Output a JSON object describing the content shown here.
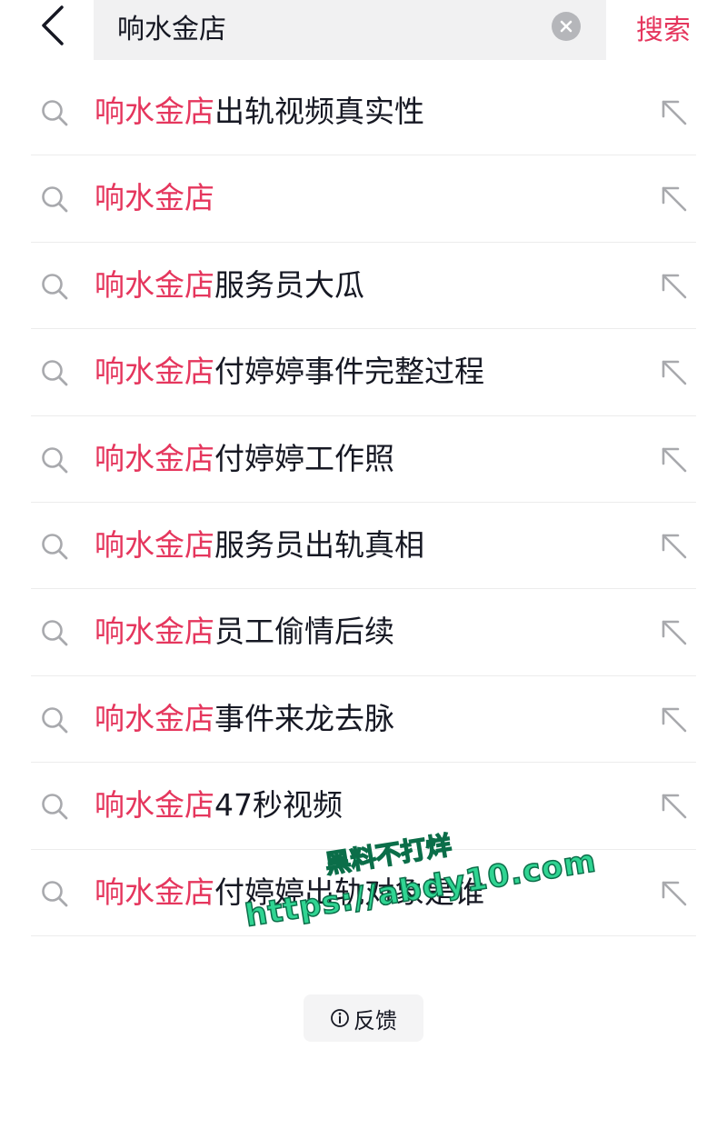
{
  "header": {
    "query": "响水金店",
    "search_label": "搜索"
  },
  "suggestions": [
    {
      "highlight": "响水金店",
      "rest": "出轨视频真实性"
    },
    {
      "highlight": "响水金店",
      "rest": ""
    },
    {
      "highlight": "响水金店",
      "rest": "服务员大瓜"
    },
    {
      "highlight": "响水金店",
      "rest": "付婷婷事件完整过程"
    },
    {
      "highlight": "响水金店",
      "rest": "付婷婷工作照"
    },
    {
      "highlight": "响水金店",
      "rest": "服务员出轨真相"
    },
    {
      "highlight": "响水金店",
      "rest": "员工偷情后续"
    },
    {
      "highlight": "响水金店",
      "rest": "事件来龙去脉"
    },
    {
      "highlight": "响水金店",
      "rest": "47秒视频"
    },
    {
      "highlight": "响水金店",
      "rest": "付婷婷出轨对象是谁"
    }
  ],
  "feedback": {
    "label": "反馈"
  },
  "watermark": {
    "line1": "黑料不打烊",
    "line2": "https://abdy10.com"
  },
  "colors": {
    "accent": "#e5365d",
    "text": "#161823",
    "search_bg": "#f1f1f2",
    "icon_gray": "#a8a9ad"
  }
}
